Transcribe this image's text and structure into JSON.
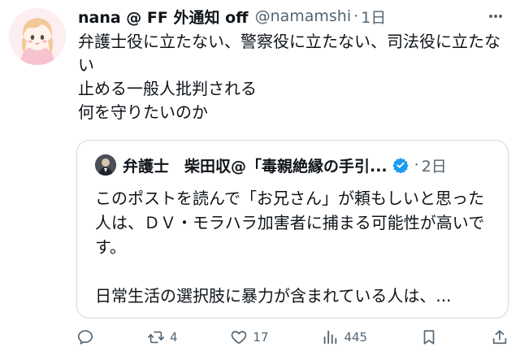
{
  "post": {
    "author_name": "nana @ FF 外通知 off",
    "handle": "@namamshi",
    "separator": "·",
    "time": "1日",
    "text": "弁護士役に立たない、警察役に立たない、司法役に立たない\n止める一般人批判される\n何を守りたいのか",
    "avatar_icon": "anime-girl-avatar",
    "more_icon": "more-horizontal-icon"
  },
  "quoted": {
    "author_name": "弁護士　柴田収@「毒親絶縁の手引...",
    "separator": "·",
    "time": "2日",
    "verified_color": "#1d9bf0",
    "text": "このポストを読んで「お兄さん」が頼もしいと思った人は、ＤＶ・モラハラ加害者に捕まる可能性が高いです。\n\n日常生活の選択肢に暴力が含まれている人は、..."
  },
  "actions": {
    "reply_icon": "reply-icon",
    "retweet_icon": "retweet-icon",
    "retweet_count": "4",
    "like_icon": "heart-icon",
    "like_count": "17",
    "views_icon": "views-icon",
    "views_count": "445",
    "bookmark_icon": "bookmark-icon",
    "share_icon": "share-icon"
  }
}
